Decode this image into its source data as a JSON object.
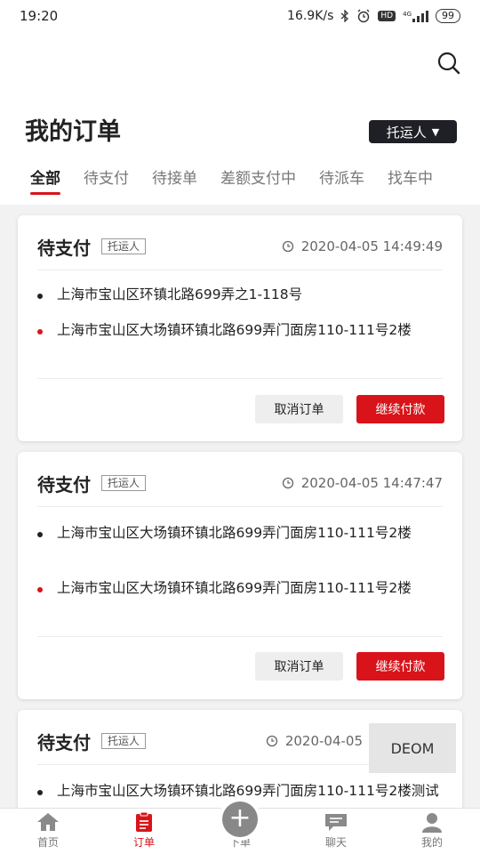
{
  "status_bar": {
    "time": "19:20",
    "network_speed": "16.9K/s",
    "bluetooth_icon": "bluetooth-icon",
    "alarm_icon": "alarm-icon",
    "hd_badge": "HD",
    "signal_label": "4G",
    "battery": "99"
  },
  "header": {
    "search_icon": "search-icon",
    "title": "我的订单",
    "role_selector": "托运人",
    "role_arrow": "▼"
  },
  "tabs": [
    {
      "label": "全部",
      "active": true
    },
    {
      "label": "待支付",
      "active": false
    },
    {
      "label": "待接单",
      "active": false
    },
    {
      "label": "差额支付中",
      "active": false
    },
    {
      "label": "待派车",
      "active": false
    },
    {
      "label": "找车中",
      "active": false
    }
  ],
  "orders": [
    {
      "status": "待支付",
      "tag": "托运人",
      "time": "2020-04-05 14:49:49",
      "start_address": "上海市宝山区环镇北路699弄之1-118号",
      "end_address": "上海市宝山区大场镇环镇北路699弄门面房110-111号2楼",
      "cancel_label": "取消订单",
      "pay_label": "继续付款"
    },
    {
      "status": "待支付",
      "tag": "托运人",
      "time": "2020-04-05 14:47:47",
      "start_address": "上海市宝山区大场镇环镇北路699弄门面房110-111号2楼",
      "end_address": "上海市宝山区大场镇环镇北路699弄门面房110-111号2楼",
      "cancel_label": "取消订单",
      "pay_label": "继续付款"
    },
    {
      "status": "待支付",
      "tag": "托运人",
      "time": "2020-04-05",
      "start_address": "上海市宝山区大场镇环镇北路699弄门面房110-111号2楼测试"
    }
  ],
  "floating_demo": "DEOM",
  "bottom_nav": [
    {
      "label": "首页",
      "icon": "home-icon"
    },
    {
      "label": "订单",
      "icon": "order-icon",
      "active": true
    },
    {
      "label": "下单",
      "icon": "plus-icon"
    },
    {
      "label": "聊天",
      "icon": "chat-icon"
    },
    {
      "label": "我的",
      "icon": "profile-icon"
    }
  ],
  "colors": {
    "accent": "#d8141a",
    "dark_button": "#1f1f26",
    "background": "#f2f2f2"
  }
}
